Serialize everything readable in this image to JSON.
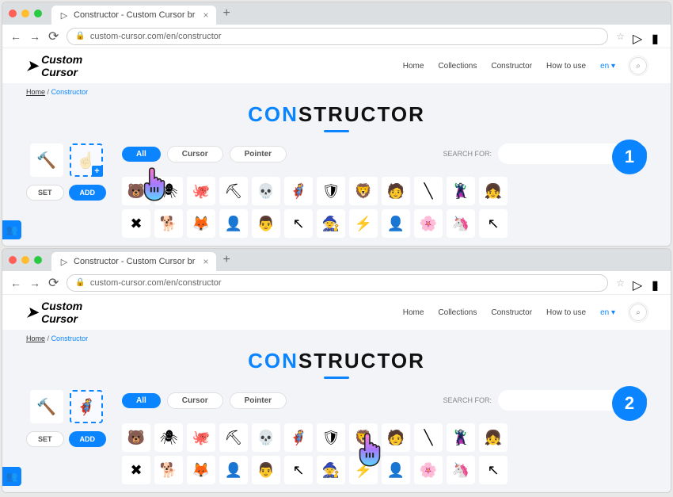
{
  "tab": {
    "title": "Constructor - Custom Cursor br",
    "close": "×",
    "plus": "+"
  },
  "url": {
    "value": "custom-cursor.com/en/constructor"
  },
  "logo": {
    "text1": "Custom",
    "text2": "Cursor"
  },
  "nav": {
    "home": "Home",
    "collections": "Collections",
    "constructor": "Constructor",
    "howto": "How to use",
    "lang": "en"
  },
  "breadcrumb": {
    "home": "Home",
    "sep": "/",
    "current": "Constructor"
  },
  "title": {
    "part1": "CON",
    "part2": "STRUCTOR"
  },
  "buttons": {
    "set": "SET",
    "add": "ADD"
  },
  "filters": {
    "all": "All",
    "cursor": "Cursor",
    "pointer": "Pointer"
  },
  "search": {
    "label": "SEARCH FOR:"
  },
  "steps": {
    "one": "1",
    "two": "2"
  },
  "grid1": [
    "🐻",
    "🕷",
    "🐙",
    "⛏",
    "💀",
    "🦸",
    "🛡",
    "🦁",
    "🧑",
    "╲",
    "🦹",
    "👧",
    "✖",
    "🐕",
    "🦊",
    "👤",
    "👨",
    "↖",
    "🧙",
    "⚡",
    "👤",
    "🌸",
    "🦄",
    "↖"
  ],
  "grid2": [
    "🐻",
    "🕷",
    "🐙",
    "⛏",
    "💀",
    "🦸",
    "🛡",
    "🦁",
    "🧑",
    "╲",
    "🦹",
    "👧",
    "✖",
    "🐕",
    "🦊",
    "👤",
    "👨",
    "↖",
    "🧙",
    "⚡",
    "👤",
    "🌸",
    "🦄",
    "↖"
  ],
  "preview": {
    "hammer": "🔨",
    "grey_hand": "☝",
    "captain": "🦸"
  },
  "plus_badge": "+"
}
